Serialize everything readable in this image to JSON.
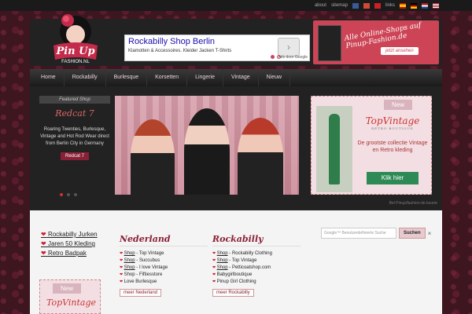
{
  "topbar": {
    "links": [
      "about",
      "sitemap",
      "links"
    ]
  },
  "logo": {
    "text": "Pin Up",
    "sub": "FASHION.NL"
  },
  "ad": {
    "title": "Rockabilly Shop Berlin",
    "text": "Klamotten & Accessoires. Kleider Jacken T-Shirts",
    "by": "Ads door Google"
  },
  "banner": {
    "line": "Alle Online-Shops auf Pinup-Fashion.de",
    "button": "jetzt ansehen"
  },
  "nav": [
    "Home",
    "Rockabilly",
    "Burlesque",
    "Korsetten",
    "Lingerie",
    "Vintage",
    "Nieuw"
  ],
  "featured": {
    "ribbon": "Featured Shop",
    "title": "Redcat 7",
    "text": "Roaring Twenties, Burlesque, Vintage and Hot Rod Wear direct from Berlin City in Germany",
    "button": "Redcat 7"
  },
  "topvintage": {
    "badge": "New",
    "logo": "TopVintage",
    "logo_sub": "RETRO BOUTIQUE",
    "text": "De grootste collectie Vintage en Retro kleding",
    "button": "Klik hier"
  },
  "credit": "Bel Pinup/fashion-de.keurte",
  "sidebar": {
    "links": [
      "Rockabilly Jurken",
      "Jaren 50 Kleding",
      "Retro Badpak"
    ],
    "mini_badge": "New",
    "mini_logo": "TopVintage"
  },
  "nederland": {
    "title": "Nederland",
    "items": [
      [
        "Shop",
        " - Top Vintage"
      ],
      [
        "Shop",
        " - Succubus"
      ],
      [
        "Shop",
        " - I love Vintage"
      ],
      [
        "",
        " Shop - Fiftiesstore"
      ],
      [
        "",
        " Love Burlesque"
      ]
    ],
    "more": "meer Nederland"
  },
  "rockabilly": {
    "title": "Rockabilly",
    "items": [
      [
        "Shop",
        " - Rockabilly Clothing"
      ],
      [
        "Shop",
        " - Top Vintage"
      ],
      [
        "Shop",
        " - Petticoatshop.com"
      ],
      [
        "",
        " Babygirlboutique"
      ],
      [
        "",
        " Pinup Girl Clothing"
      ]
    ],
    "more": "meer Rockabilly"
  },
  "search": {
    "placeholder": "Google™ Benutzerdefinierte Suche",
    "button": "Suchen",
    "close": "×"
  }
}
